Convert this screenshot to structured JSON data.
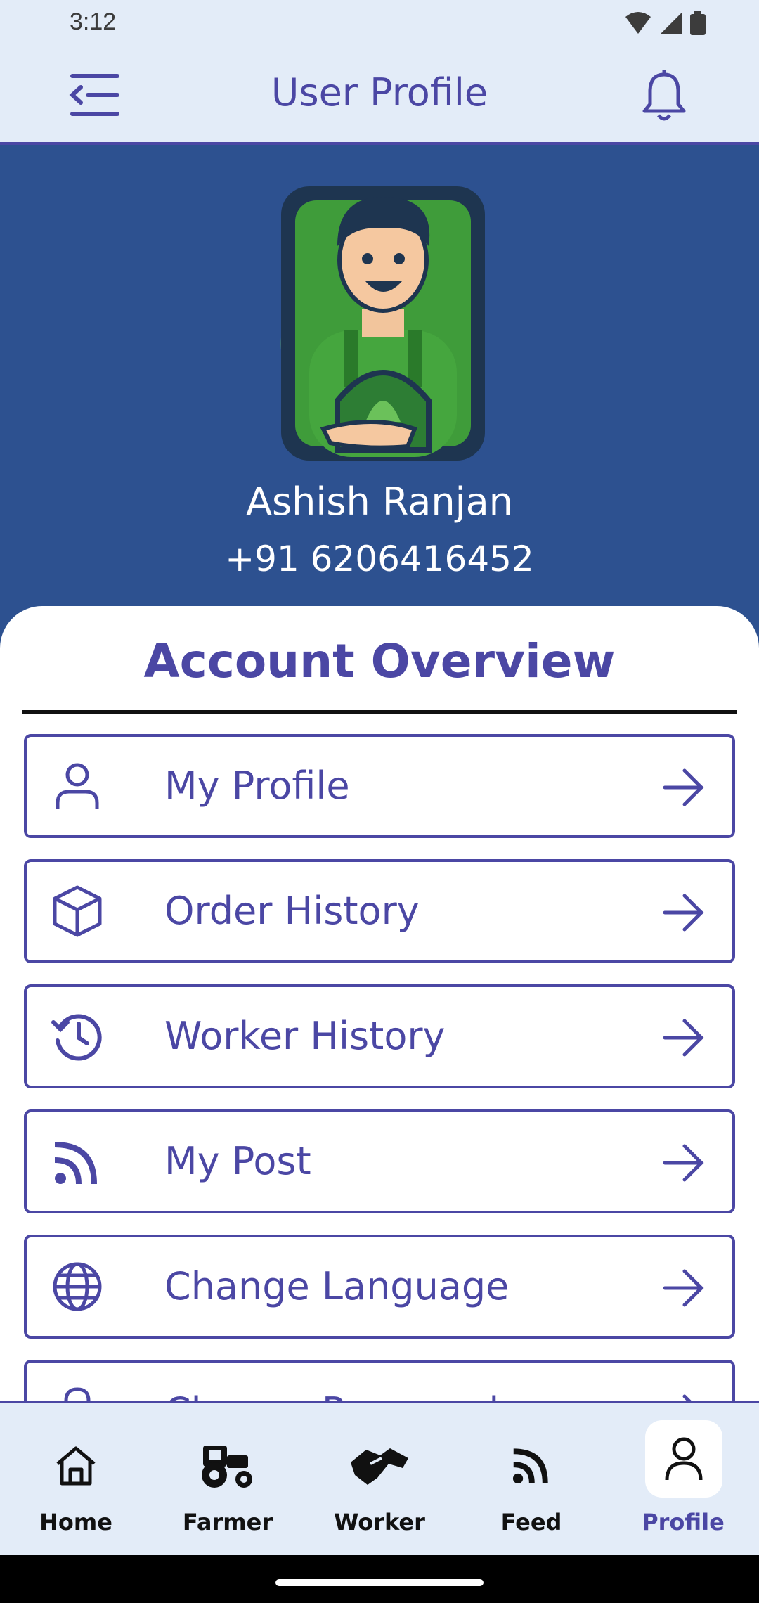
{
  "status_bar": {
    "time": "3:12",
    "icons": [
      "wifi-icon",
      "signal-icon",
      "battery-icon"
    ]
  },
  "app_bar": {
    "title": "User Profile",
    "left_icon": "menu-collapse-icon",
    "right_icon": "bell-icon"
  },
  "profile": {
    "name": "Ashish Ranjan",
    "phone": "+91 6206416452"
  },
  "section": {
    "title": "Account Overview"
  },
  "menu": {
    "items": [
      {
        "label": "My Profile",
        "icon": "person-icon"
      },
      {
        "label": "Order History",
        "icon": "box-icon"
      },
      {
        "label": "Worker History",
        "icon": "history-icon"
      },
      {
        "label": "My Post",
        "icon": "rss-icon"
      },
      {
        "label": "Change Language",
        "icon": "globe-icon"
      },
      {
        "label": "Change Password",
        "icon": "lock-icon"
      }
    ]
  },
  "bottom_nav": {
    "items": [
      {
        "label": "Home",
        "icon": "home-icon"
      },
      {
        "label": "Farmer",
        "icon": "tractor-icon"
      },
      {
        "label": "Worker",
        "icon": "handshake-icon"
      },
      {
        "label": "Feed",
        "icon": "rss-icon"
      },
      {
        "label": "Profile",
        "icon": "person-icon"
      }
    ],
    "active": "Profile"
  },
  "colors": {
    "primary": "#4b47a4",
    "header_bg": "#2d5190",
    "bar_bg": "#e3ecf8"
  }
}
